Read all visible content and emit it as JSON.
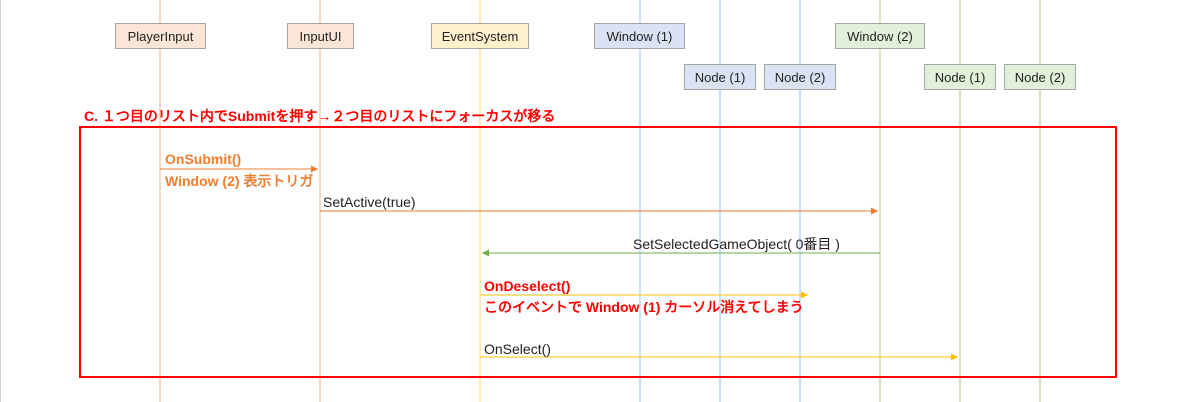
{
  "participants": [
    {
      "id": "player-input",
      "label": "PlayerInput"
    },
    {
      "id": "input-ui",
      "label": "InputUI"
    },
    {
      "id": "event-system",
      "label": "EventSystem"
    },
    {
      "id": "window-1",
      "label": "Window (1)"
    },
    {
      "id": "node-1-of-window-1",
      "label": "Node (1)"
    },
    {
      "id": "node-2-of-window-1",
      "label": "Node (2)"
    },
    {
      "id": "window-2",
      "label": "Window (2)"
    },
    {
      "id": "node-1-of-window-2",
      "label": "Node (1)"
    },
    {
      "id": "node-2-of-window-2",
      "label": "Node (2)"
    }
  ],
  "frame": {
    "title": "C. １つ目のリスト内でSubmitを押す→２つ目のリストにフォーカスが移る"
  },
  "messages": [
    {
      "id": "on-submit",
      "from": "player-input",
      "to": "input-ui",
      "label": "OnSubmit()",
      "sub_label": "Window (2) 表示トリガ",
      "color": "#ed7d31"
    },
    {
      "id": "set-active",
      "from": "input-ui",
      "to": "window-2",
      "label": "SetActive(true)",
      "color": "#ed7d31"
    },
    {
      "id": "set-selected",
      "from": "window-2",
      "to": "event-system",
      "label": "SetSelectedGameObject( 0番目 )",
      "color": "#70ad47"
    },
    {
      "id": "on-deselect",
      "from": "event-system",
      "to": "node-2-of-window-1",
      "label": "OnDeselect()",
      "sub_label": "このイベントで Window (1) カーソル消えてしまう",
      "color": "#ffc000"
    },
    {
      "id": "on-select",
      "from": "event-system",
      "to": "node-1-of-window-2",
      "label": "OnSelect()",
      "color": "#ffc000"
    }
  ],
  "colors": {
    "orange_lifeline": "#f4b183",
    "yellow_lifeline": "#ffd966",
    "blue_lifeline": "#9dc3e6",
    "green_lifeline": "#a9d18e",
    "frame": "#ff0000"
  }
}
